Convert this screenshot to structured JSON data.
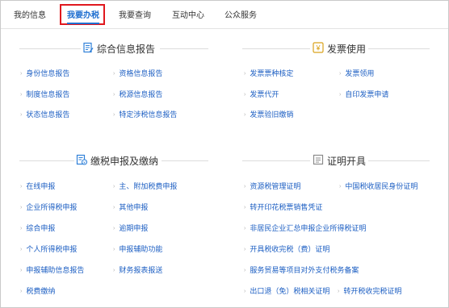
{
  "nav": {
    "tabs": [
      {
        "label": "我的信息"
      },
      {
        "label": "我要办税"
      },
      {
        "label": "我要查询"
      },
      {
        "label": "互动中心"
      },
      {
        "label": "公众服务"
      }
    ],
    "active_index": 1
  },
  "sections": {
    "info_report": {
      "title": "综合信息报告",
      "icon": "document-edit-icon",
      "items": [
        "身份信息报告",
        "资格信息报告",
        "制度信息报告",
        "税源信息报告",
        "状态信息报告",
        "特定涉税信息报告"
      ]
    },
    "invoice": {
      "title": "发票使用",
      "icon": "yen-icon",
      "items": [
        "发票票种核定",
        "发票领用",
        "发票代开",
        "自印发票申请",
        "发票验旧缴销"
      ]
    },
    "tax_filing": {
      "title": "缴税申报及缴纳",
      "icon": "tax-form-icon",
      "items": [
        "在线申报",
        "主、附加税费申报",
        "企业所得税申报",
        "其他申报",
        "综合申报",
        "逾期申报",
        "个人所得税申报",
        "申报辅助功能",
        "申报辅助信息报告",
        "财务报表报送",
        "税费缴纳"
      ]
    },
    "certificate": {
      "title": "证明开具",
      "icon": "certificate-icon",
      "items": [
        "资源税管理证明",
        "中国税收居民身份证明",
        "转开印花税票销售凭证",
        "非居民企业汇总申报企业所得税证明",
        "开具税收完税（费）证明",
        "服务贸易等项目对外支付税务备案",
        "出口退（免）税相关证明",
        "转开税收完税证明"
      ]
    }
  },
  "colors": {
    "accent": "#1f6fd0",
    "link": "#1d5fc3",
    "highlight_box": "#e0181e",
    "icon_blue": "#2f80d8",
    "icon_gold": "#d9a21b"
  }
}
